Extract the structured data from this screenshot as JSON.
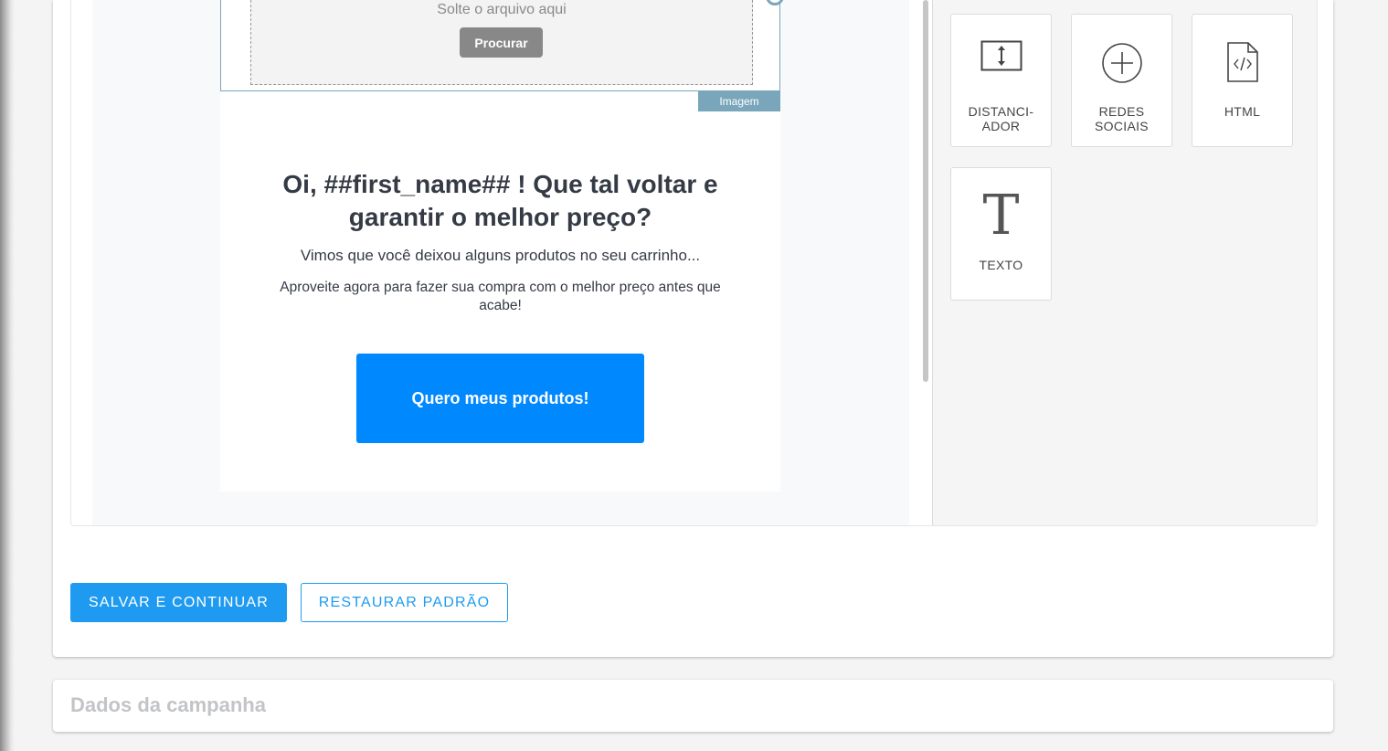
{
  "email_preview": {
    "image_block": {
      "drop_text": "Solte o arquivo aqui",
      "browse_label": "Procurar",
      "tag_label": "Imagem"
    },
    "headline": "Oi, ##first_name## ! Que tal voltar e garantir o melhor preço?",
    "subtitle": "Vimos que você deixou alguns produtos no seu carrinho...",
    "body_text": "Aproveite agora para fazer sua compra com o melhor preço antes que acabe!",
    "cta_label": "Quero meus produtos!"
  },
  "blocks_panel": {
    "items": [
      {
        "label_line1": "DISTANCI-",
        "label_line2": "ADOR",
        "icon": "spacer-icon"
      },
      {
        "label_line1": "REDES",
        "label_line2": "SOCIAIS",
        "icon": "plus-circle-icon"
      },
      {
        "label_line1": "HTML",
        "label_line2": "",
        "icon": "code-file-icon"
      },
      {
        "label_line1": "TEXTO",
        "label_line2": "",
        "icon": "text-t-icon"
      }
    ]
  },
  "actions": {
    "save_label": "SALVAR E CONTINUAR",
    "restore_label": "RESTAURAR PADRÃO"
  },
  "campaign_section": {
    "title": "Dados da campanha"
  },
  "colors": {
    "primary": "#1e9bf0",
    "cta": "#0088ff",
    "selection": "#7aa6bb",
    "headline_text": "#353b45"
  }
}
